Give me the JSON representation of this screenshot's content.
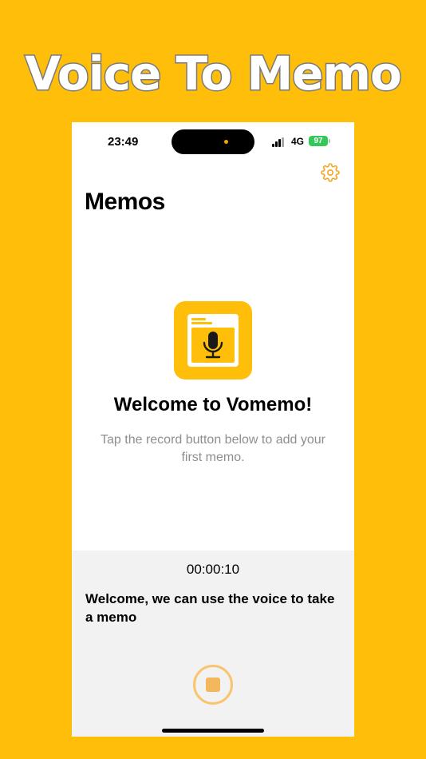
{
  "promo": {
    "headline": "Voice To Memo"
  },
  "status_bar": {
    "time": "23:49",
    "network": "4G",
    "battery": "97"
  },
  "header": {
    "title": "Memos",
    "settings_icon": "gear-icon"
  },
  "empty_state": {
    "icon": "microphone-app-icon",
    "title": "Welcome to Vomemo!",
    "subtitle": "Tap the record button below to add your first memo."
  },
  "recorder": {
    "elapsed": "00:00:10",
    "transcript": "Welcome, we can use the voice to take a memo",
    "stop_icon": "stop-icon"
  },
  "colors": {
    "brand_yellow": "#FFBE0A",
    "accent_orange": "#F5A623",
    "panel_gray": "#F2F2F2",
    "battery_green": "#34C759"
  }
}
